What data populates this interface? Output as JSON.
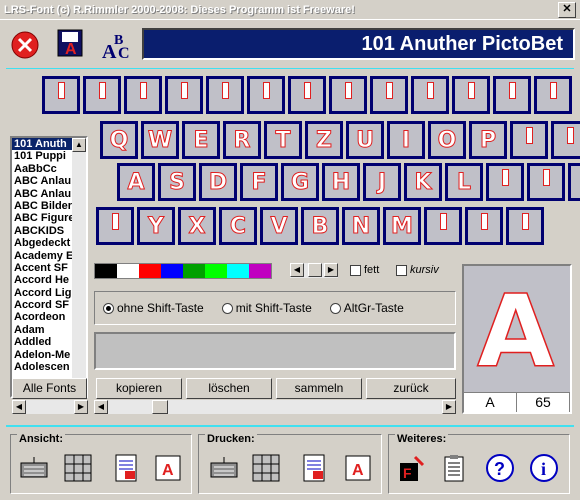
{
  "window": {
    "title": "LRS-Font (c) R.Rimmler 2000-2008: Dieses Programm ist Freeware!",
    "close_glyph": "✕"
  },
  "banner": {
    "font_title": "101 Anuther PictoBet"
  },
  "keyboard": {
    "row1": [
      "",
      "",
      "",
      "",
      "",
      "",
      "",
      "",
      "",
      "",
      "",
      "",
      ""
    ],
    "row2": [
      "Q",
      "W",
      "E",
      "R",
      "T",
      "Z",
      "U",
      "I",
      "O",
      "P",
      "",
      ""
    ],
    "row3": [
      "A",
      "S",
      "D",
      "F",
      "G",
      "H",
      "J",
      "K",
      "L",
      "",
      "",
      ""
    ],
    "row4": [
      "",
      "Y",
      "X",
      "C",
      "V",
      "B",
      "N",
      "M",
      "",
      "",
      ""
    ]
  },
  "font_list": {
    "items": [
      "101 Anuth",
      "101 Puppi",
      "AaBbCc",
      "ABC Anlau",
      "ABC Anlau",
      "ABC Bilder",
      "ABC Figure",
      "ABCKIDS",
      "Abgedeckt",
      "Academy E",
      "Accent SF",
      "Accord He",
      "Accord Lig",
      "Accord SF",
      "Acordeon",
      "Adam",
      "Addled",
      "Adelon-Me",
      "Adolescen"
    ],
    "selected_index": 0
  },
  "palette": [
    "#000000",
    "#ffffff",
    "#ff0000",
    "#0000ff",
    "#00a000",
    "#00ff00",
    "#00ffff",
    "#c000c0"
  ],
  "options": {
    "bold_label": "fett",
    "italic_label": "kursiv"
  },
  "shift_modes": {
    "items": [
      "ohne Shift-Taste",
      "mit Shift-Taste",
      "AltGr-Taste"
    ],
    "selected_index": 0
  },
  "buttons": {
    "all_fonts": "Alle Fonts",
    "copy": "kopieren",
    "delete": "löschen",
    "collect": "sammeln",
    "back": "zurück"
  },
  "preview": {
    "char": "A",
    "code": "65",
    "big_char": "A"
  },
  "groups": {
    "view": "Ansicht:",
    "print": "Drucken:",
    "more": "Weiteres:"
  },
  "colors": {
    "banner_bg": "#0a1e6e",
    "key_frame": "#000070",
    "key_outline": "#e02020",
    "accent_line": "#40e0f0"
  }
}
